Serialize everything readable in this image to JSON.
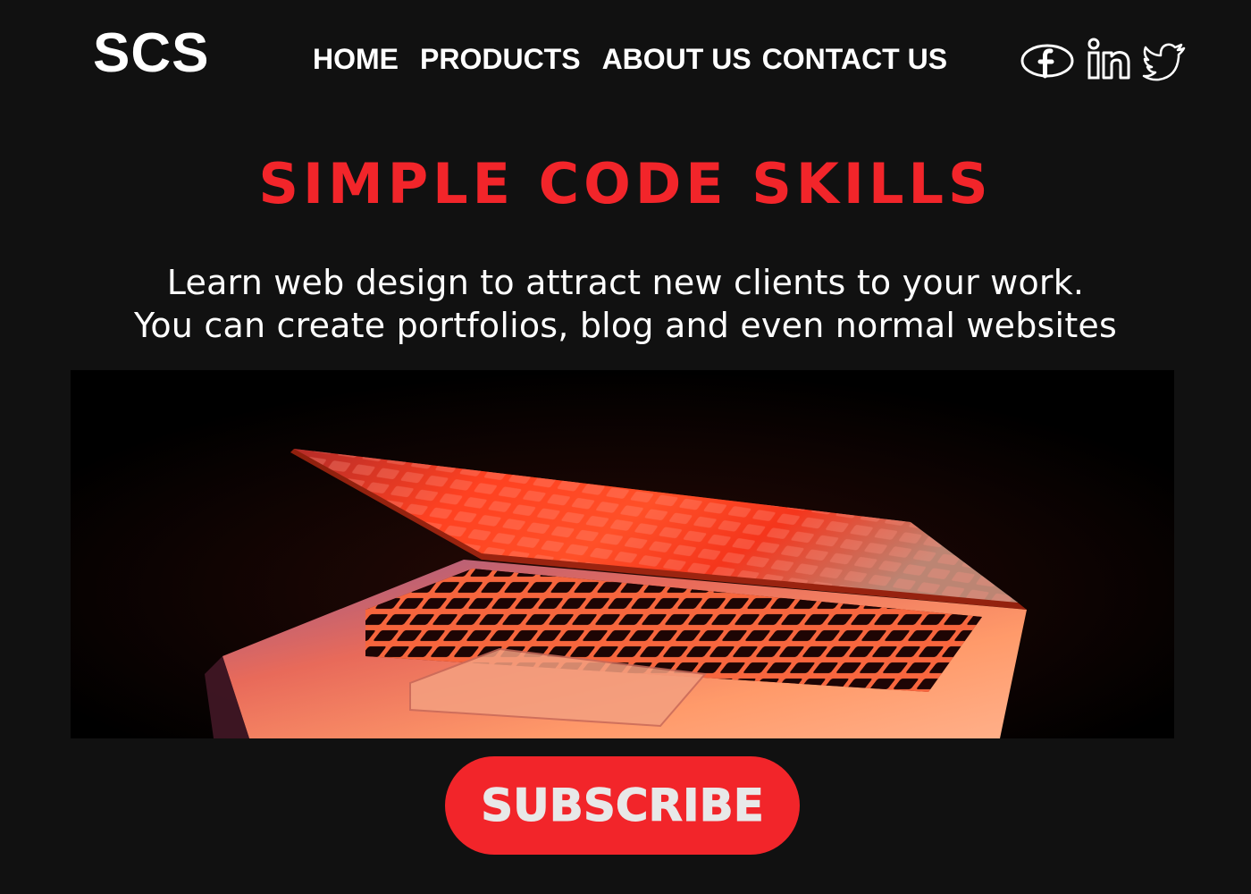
{
  "brand": {
    "logo": "SCS"
  },
  "nav": {
    "items": [
      "HOME",
      "PRODUCTS",
      "ABOUT US",
      "CONTACT US"
    ]
  },
  "socials": [
    {
      "icon": "facebook-icon"
    },
    {
      "icon": "linkedin-icon"
    },
    {
      "icon": "twitter-icon"
    }
  ],
  "hero": {
    "title": "SIMPLE CODE SKILLS",
    "subtitle_line1": "Learn web design to attract new clients to your work.",
    "subtitle_line2": "You can create portfolios, blog and even normal websites",
    "image": "laptop-photo"
  },
  "cta": {
    "subscribe_label": "SUBSCRIBE"
  },
  "colors": {
    "background": "#111111",
    "accent": "#f2252a",
    "text": "#ffffff",
    "button_text": "#e8e8e8"
  }
}
